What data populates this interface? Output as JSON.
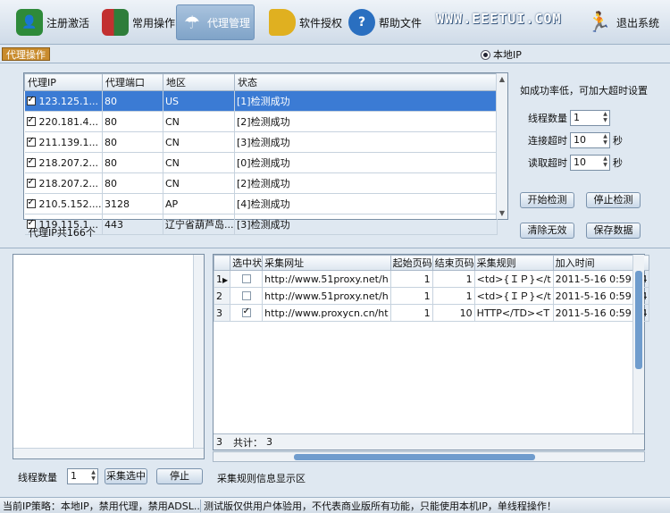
{
  "toolbar": {
    "items": [
      {
        "label": "注册激活",
        "icon": "user-icon",
        "color": "#2e8a3a"
      },
      {
        "label": "常用操作",
        "icon": "book-icon",
        "color": "#2e7d3a"
      },
      {
        "label": "代理管理",
        "icon": "umbrella-icon",
        "color": "#3a6ea8"
      },
      {
        "label": "软件授权",
        "icon": "tag-icon",
        "color": "#e0b020"
      },
      {
        "label": "帮助文件",
        "icon": "help-icon",
        "color": "#2a6fc0"
      }
    ],
    "logo": "WWW.EEETUI.COM",
    "exit_label": "退出系统"
  },
  "section_tab": "代理操作",
  "local_ip_label": "本地IP",
  "proxy_table": {
    "headers": [
      "代理IP",
      "代理端口",
      "地区",
      "状态"
    ],
    "rows": [
      {
        "ip": "123.125.1...",
        "port": "80",
        "region": "US",
        "status": "[1]检测成功"
      },
      {
        "ip": "220.181.4...",
        "port": "80",
        "region": "CN",
        "status": "[2]检测成功"
      },
      {
        "ip": "211.139.1...",
        "port": "80",
        "region": "CN",
        "status": "[3]检测成功"
      },
      {
        "ip": "218.207.2...",
        "port": "80",
        "region": "CN",
        "status": "[0]检测成功"
      },
      {
        "ip": "218.207.2...",
        "port": "80",
        "region": "CN",
        "status": "[2]检测成功"
      },
      {
        "ip": "210.5.152....",
        "port": "3128",
        "region": "AP",
        "status": "[4]检测成功"
      },
      {
        "ip": "119.115.1...",
        "port": "443",
        "region": "辽宁省葫芦岛...",
        "status": "[3]检测成功"
      }
    ],
    "count_text": "代理IP共166个"
  },
  "settings": {
    "hint": "如成功率低，可加大超时设置",
    "thread_label": "线程数量",
    "thread_value": "1",
    "connect_label": "连接超时",
    "connect_value": "10",
    "read_label": "读取超时",
    "read_value": "10",
    "unit": "秒",
    "start_check": "开始检测",
    "stop_check": "停止检测",
    "clear_invalid": "清除无效",
    "save_data": "保存数据"
  },
  "rule_grid": {
    "headers": [
      "",
      "选中状",
      "采集网址",
      "起始页码",
      "结束页码",
      "采集规则",
      "加入时间"
    ],
    "rows": [
      {
        "idx": "1",
        "marker": "▶",
        "checked": false,
        "url": "http://www.51proxy.net/h",
        "start": "1",
        "end": "1",
        "rule": "<td>{ＩＰ}</t",
        "time": "2011-5-16 0:59:34"
      },
      {
        "idx": "2",
        "marker": "",
        "checked": false,
        "url": "http://www.51proxy.net/h",
        "start": "1",
        "end": "1",
        "rule": "<td>{ＩＰ}</t",
        "time": "2011-5-16 0:59:34"
      },
      {
        "idx": "3",
        "marker": "",
        "checked": true,
        "url": "http://www.proxycn.cn/ht",
        "start": "1",
        "end": "10",
        "rule": "HTTP</TD><T",
        "time": "2011-5-16 0:59:34"
      }
    ],
    "footer_idx": "3",
    "footer_label": "共计：",
    "footer_count": "3"
  },
  "bottom_controls": {
    "threads_label": "线程数量",
    "threads_value": "1",
    "collect_selected": "采集选中",
    "stop": "停止"
  },
  "rule_info": "采集规则信息显示区",
  "status_bar": {
    "left": "当前IP策略：本地IP，禁用代理，禁用ADSL...",
    "right": "测试版仅供用户体验用，不代表商业版所有功能，只能使用本机IP，单线程操作！"
  }
}
